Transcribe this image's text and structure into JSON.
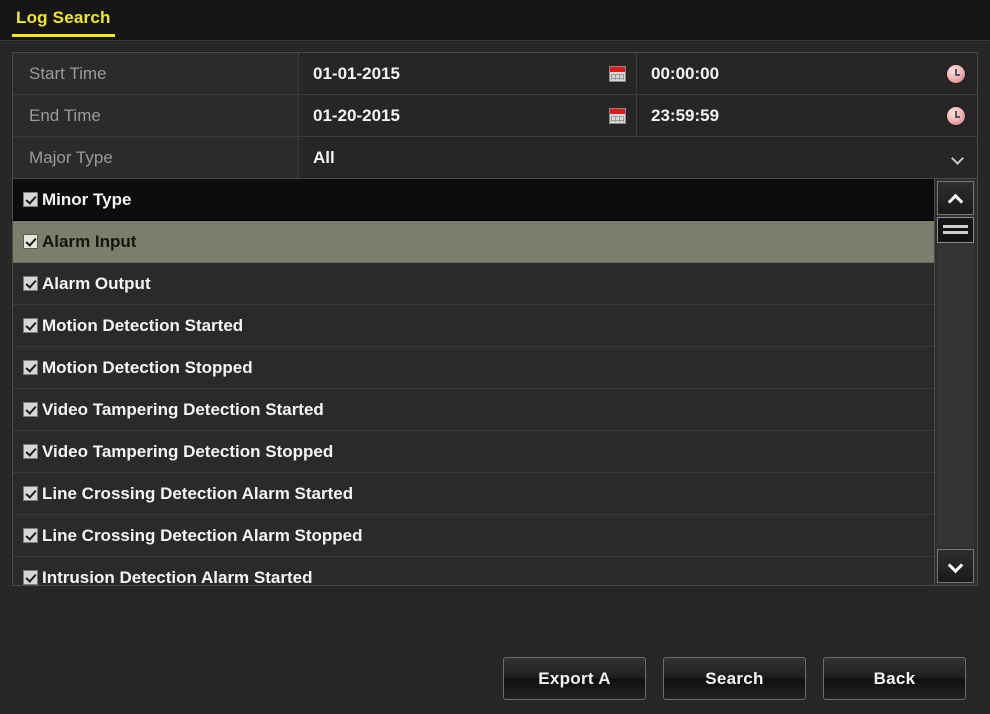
{
  "titlebar": {
    "tab_label": "Log Search"
  },
  "form": {
    "rows": [
      {
        "label": "Start Time",
        "date": "01-01-2015",
        "time": "00:00:00",
        "date_icon": "calendar-icon",
        "time_icon": "clock-icon"
      },
      {
        "label": "End Time",
        "date": "01-20-2015",
        "time": "23:59:59",
        "date_icon": "calendar-icon",
        "time_icon": "clock-icon"
      }
    ],
    "major_type": {
      "label": "Major Type",
      "value": "All",
      "icon": "chevron-down-icon"
    }
  },
  "minor_type_list": {
    "header": {
      "label": "Minor Type",
      "checked": true
    },
    "items": [
      {
        "label": "Alarm Input",
        "checked": true,
        "selected": true
      },
      {
        "label": "Alarm Output",
        "checked": true,
        "selected": false
      },
      {
        "label": "Motion Detection Started",
        "checked": true,
        "selected": false
      },
      {
        "label": "Motion Detection Stopped",
        "checked": true,
        "selected": false
      },
      {
        "label": "Video Tampering Detection Started",
        "checked": true,
        "selected": false
      },
      {
        "label": "Video Tampering Detection Stopped",
        "checked": true,
        "selected": false
      },
      {
        "label": "Line Crossing Detection Alarm Started",
        "checked": true,
        "selected": false
      },
      {
        "label": "Line Crossing Detection Alarm Stopped",
        "checked": true,
        "selected": false
      },
      {
        "label": "Intrusion Detection Alarm Started",
        "checked": true,
        "selected": false
      }
    ],
    "scrollbar": {
      "up_icon": "chevron-up-icon",
      "down_icon": "chevron-down-icon",
      "thumb_icon": "scroll-thumb-grip"
    }
  },
  "buttons": {
    "export": "Export A",
    "search": "Search",
    "back": "Back"
  },
  "colors": {
    "background": "#272727",
    "tab_accent": "#f2ea17",
    "row_selected": "#7d7d6b",
    "calendar_red": "#e01a1a",
    "clock_pink": "#f6b8b8"
  }
}
